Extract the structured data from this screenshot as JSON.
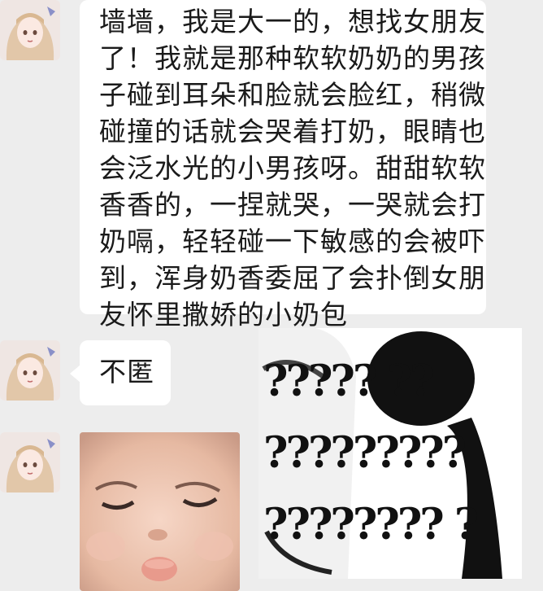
{
  "messages": [
    {
      "type": "text",
      "lines": [
        "墙墙，我是大一的，想找女朋友",
        "了！我就是那种软软奶奶的男孩",
        "子碰到耳朵和脸就会脸红，稍微",
        "碰撞的话就会哭着打奶，眼睛也",
        "会泛水光的小男孩呀。甜甜软软",
        "香香的，一捏就哭，一哭就会打",
        "奶嗝，轻轻碰一下敏感的会被吓",
        "到，浑身奶香委屈了会扑倒女朋",
        "友怀里撒娇的小奶包"
      ]
    },
    {
      "type": "text",
      "text": "不匿"
    },
    {
      "type": "images",
      "meme_rows": [
        "????? ??",
        "?????????",
        "???????? ?"
      ]
    }
  ],
  "colors": {
    "background": "#ededed",
    "bubble": "#ffffff",
    "text": "#1a1a1a"
  },
  "icons": {
    "avatar": "anime-girl-avatar-icon"
  }
}
